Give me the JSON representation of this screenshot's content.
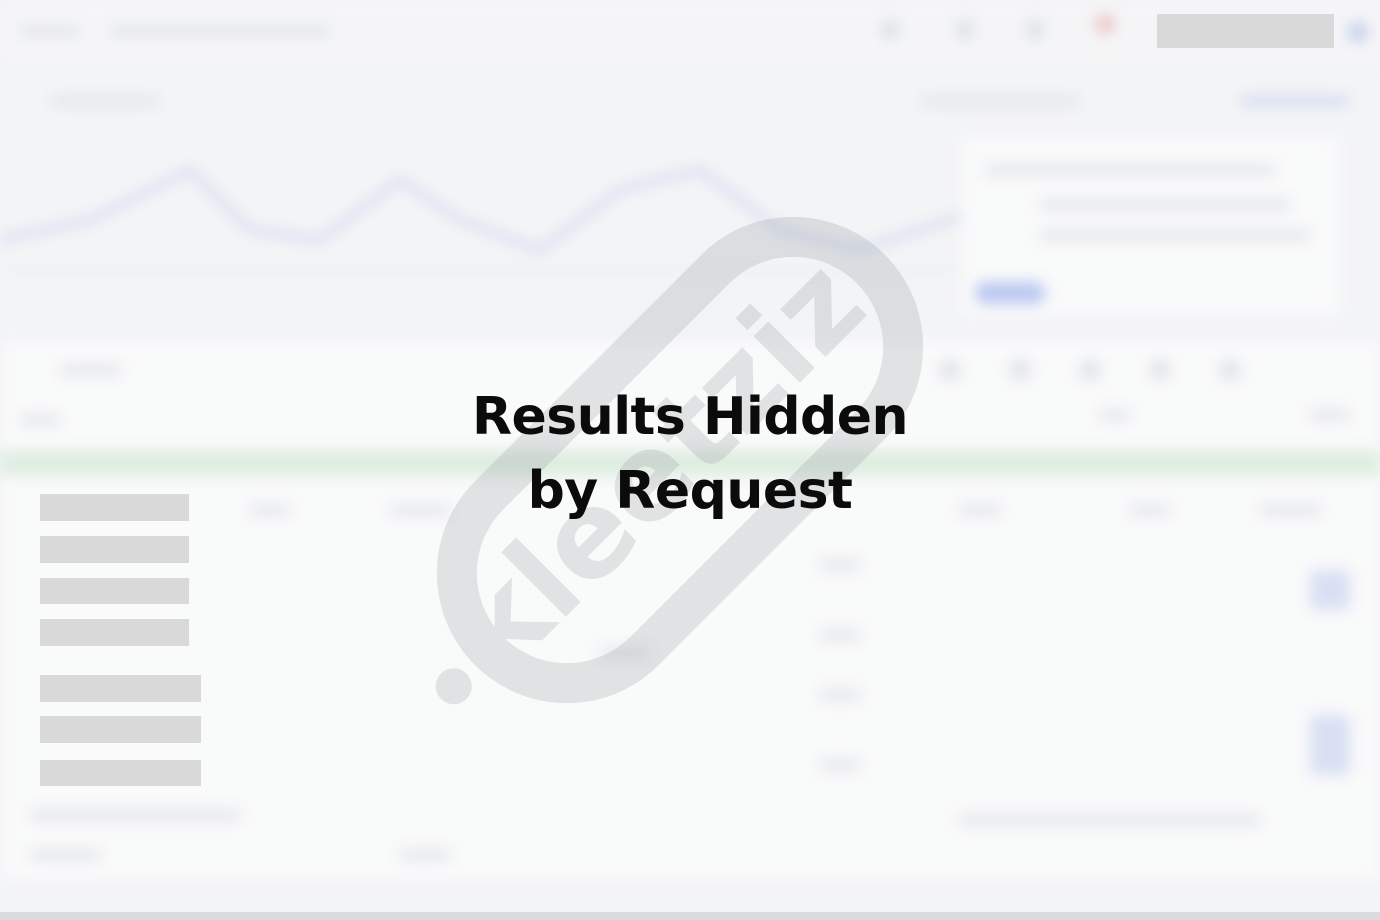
{
  "overlay": {
    "line1": "Results Hidden",
    "line2": "by Request"
  },
  "watermark": {
    "brand": "kleetzizi"
  },
  "colors": {
    "text": "#0b0b0b",
    "redaction": "#d9d9d9",
    "accent_blurred": "#8ea6ee",
    "background": "#f3f4f6"
  },
  "icons": {
    "watermark_logo": "brand-logo-icon"
  }
}
